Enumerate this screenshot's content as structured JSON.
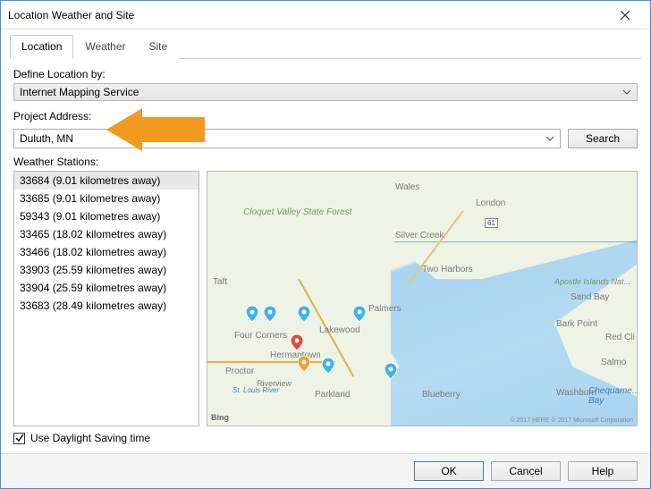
{
  "window": {
    "title": "Location Weather and Site"
  },
  "tabs": {
    "location": "Location",
    "weather": "Weather",
    "site": "Site"
  },
  "define": {
    "label": "Define Location by:",
    "value": "Internet Mapping Service"
  },
  "project": {
    "label": "Project Address:",
    "value": "Duluth, MN",
    "search_btn": "Search"
  },
  "stations": {
    "label": "Weather Stations:",
    "items": [
      "33684 (9.01 kilometres away)",
      "33685 (9.01 kilometres away)",
      "59343 (9.01 kilometres away)",
      "33465 (18.02 kilometres away)",
      "33466 (18.02 kilometres away)",
      "33903 (25.59 kilometres away)",
      "33904 (25.59 kilometres away)",
      "33683 (28.49 kilometres away)"
    ]
  },
  "map": {
    "places": {
      "wales": "Wales",
      "london": "London",
      "cloquet": "Cloquet Valley State Forest",
      "silver_creek": "Silver Creek",
      "two_harbors": "Two Harbors",
      "taft": "Taft",
      "apostle": "Apostle Islands Nat...",
      "sand_bay": "Sand Bay",
      "palmers": "Palmers",
      "bark_point": "Bark Point",
      "four_corners": "Four Corners",
      "lakewood": "Lakewood",
      "red_cli": "Red Cli",
      "hermantown": "Hermantown",
      "proctor": "Proctor",
      "salmo": "Salmo",
      "riverview": "Riverview",
      "st_louis": "St. Louis River",
      "parkland": "Parkland",
      "blueberry": "Blueberry",
      "washburn": "Washburn",
      "chequame": "Chequame... Bay"
    },
    "bing": "Bing",
    "copyright": "© 2017 HERE © 2017 Microsoft Corporation"
  },
  "daylight": {
    "label": "Use Daylight Saving time"
  },
  "buttons": {
    "ok": "OK",
    "cancel": "Cancel",
    "help": "Help"
  }
}
